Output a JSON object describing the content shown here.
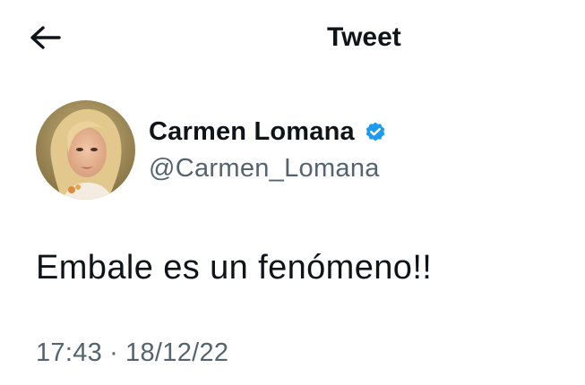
{
  "header": {
    "title": "Tweet",
    "back_icon": "arrow-left-icon"
  },
  "author": {
    "display_name": "Carmen Lomana",
    "handle": "@Carmen_Lomana",
    "verified_icon": "verified-badge-icon",
    "verified_color": "#1d9bf0"
  },
  "tweet": {
    "text": "Embale es un fenómeno!!",
    "time": "17:43",
    "separator": "·",
    "date": "18/12/22"
  },
  "colors": {
    "primary_text": "#0f1419",
    "secondary_text": "#536471",
    "background": "#ffffff"
  }
}
